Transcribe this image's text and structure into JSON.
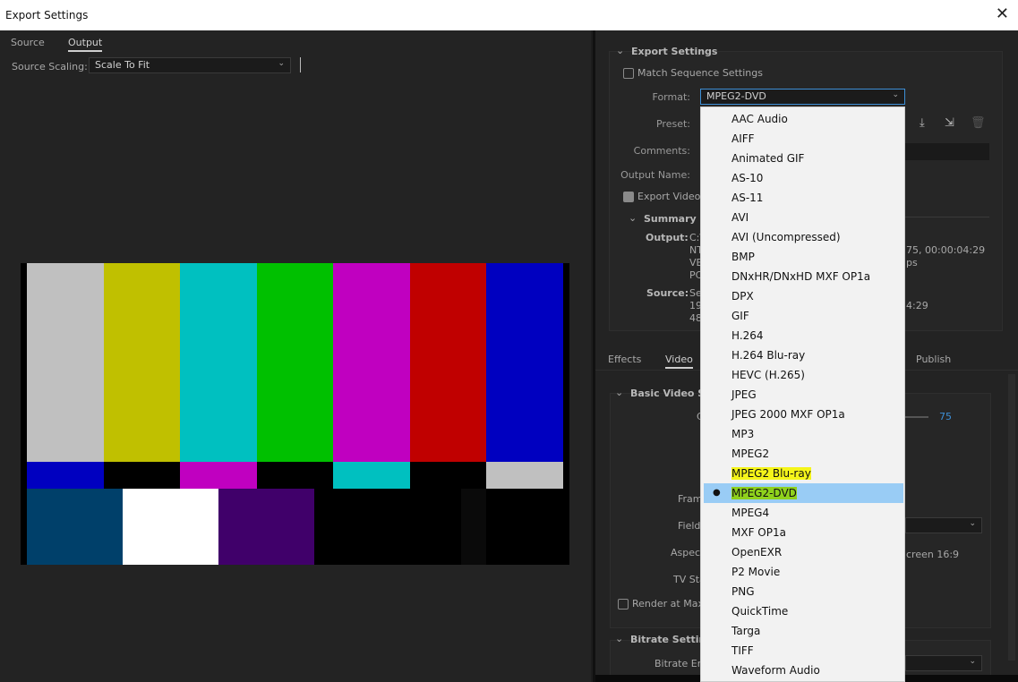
{
  "window": {
    "title": "Export Settings",
    "close": "✕"
  },
  "left": {
    "tabs": [
      {
        "label": "Source"
      },
      {
        "label": "Output",
        "active": true
      }
    ],
    "source_scaling_label": "Source Scaling:",
    "source_scaling_value": "Scale To Fit",
    "color_bars": {
      "top": [
        "#c0c0c0",
        "#c0c000",
        "#00c0c0",
        "#00c000",
        "#c000c0",
        "#c00000",
        "#0000c0"
      ],
      "middle": [
        "#0000c0",
        "#000000",
        "#c000c0",
        "#000000",
        "#00c0c0",
        "#000000",
        "#c0c0c0"
      ],
      "bottom": [
        "#00406a",
        "#ffffff",
        "#40006a",
        "#000000",
        "#000000",
        "#0a0a0a",
        "#000000"
      ]
    }
  },
  "export_settings": {
    "title": "Export Settings",
    "match_sequence": "Match Sequence Settings",
    "format_label": "Format:",
    "format_value": "MPEG2-DVD",
    "preset_label": "Preset:",
    "comments_label": "Comments:",
    "output_name_label": "Output Name:",
    "export_video": "Export Video",
    "summary": {
      "title": "Summary",
      "output_label": "Output:",
      "output_lines": [
        "C:\\",
        "NT",
        "VB",
        "PC"
      ],
      "output_right": [
        "75, 00:00:04:29",
        "ps"
      ],
      "source_label": "Source:",
      "source_lines": [
        "Se",
        "19",
        "48"
      ],
      "source_right": "4:29"
    }
  },
  "tabs": [
    {
      "label": "Effects"
    },
    {
      "label": "Video",
      "active": true
    },
    {
      "label": "Publish"
    }
  ],
  "video": {
    "basic_title": "Basic Video Se",
    "quality_label": "C",
    "quality_value": "75",
    "frame_label": "Fram",
    "field_label": "Field",
    "aspect_label": "Aspect",
    "aspect_value": "creen 16:9",
    "tv_label": "TV Sta",
    "render_max": "Render at Maxi",
    "bitrate_title": "Bitrate Settin",
    "bitrate_label": "Bitrate En"
  },
  "format_dropdown": {
    "selected": "MPEG2-DVD",
    "highlighted": "MPEG2 Blu-ray",
    "items": [
      "AAC Audio",
      "AIFF",
      "Animated GIF",
      "AS-10",
      "AS-11",
      "AVI",
      "AVI (Uncompressed)",
      "BMP",
      "DNxHR/DNxHD MXF OP1a",
      "DPX",
      "GIF",
      "H.264",
      "H.264 Blu-ray",
      "HEVC (H.265)",
      "JPEG",
      "JPEG 2000 MXF OP1a",
      "MP3",
      "MPEG2",
      "MPEG2 Blu-ray",
      "MPEG2-DVD",
      "MPEG4",
      "MXF OP1a",
      "OpenEXR",
      "P2 Movie",
      "PNG",
      "QuickTime",
      "Targa",
      "TIFF",
      "Waveform Audio"
    ]
  },
  "colors": {
    "accent": "#99ccf5",
    "value_blue": "#3d8fd6",
    "highlight_yellow": "#f5f51a",
    "highlight_green": "#8fd11c"
  }
}
